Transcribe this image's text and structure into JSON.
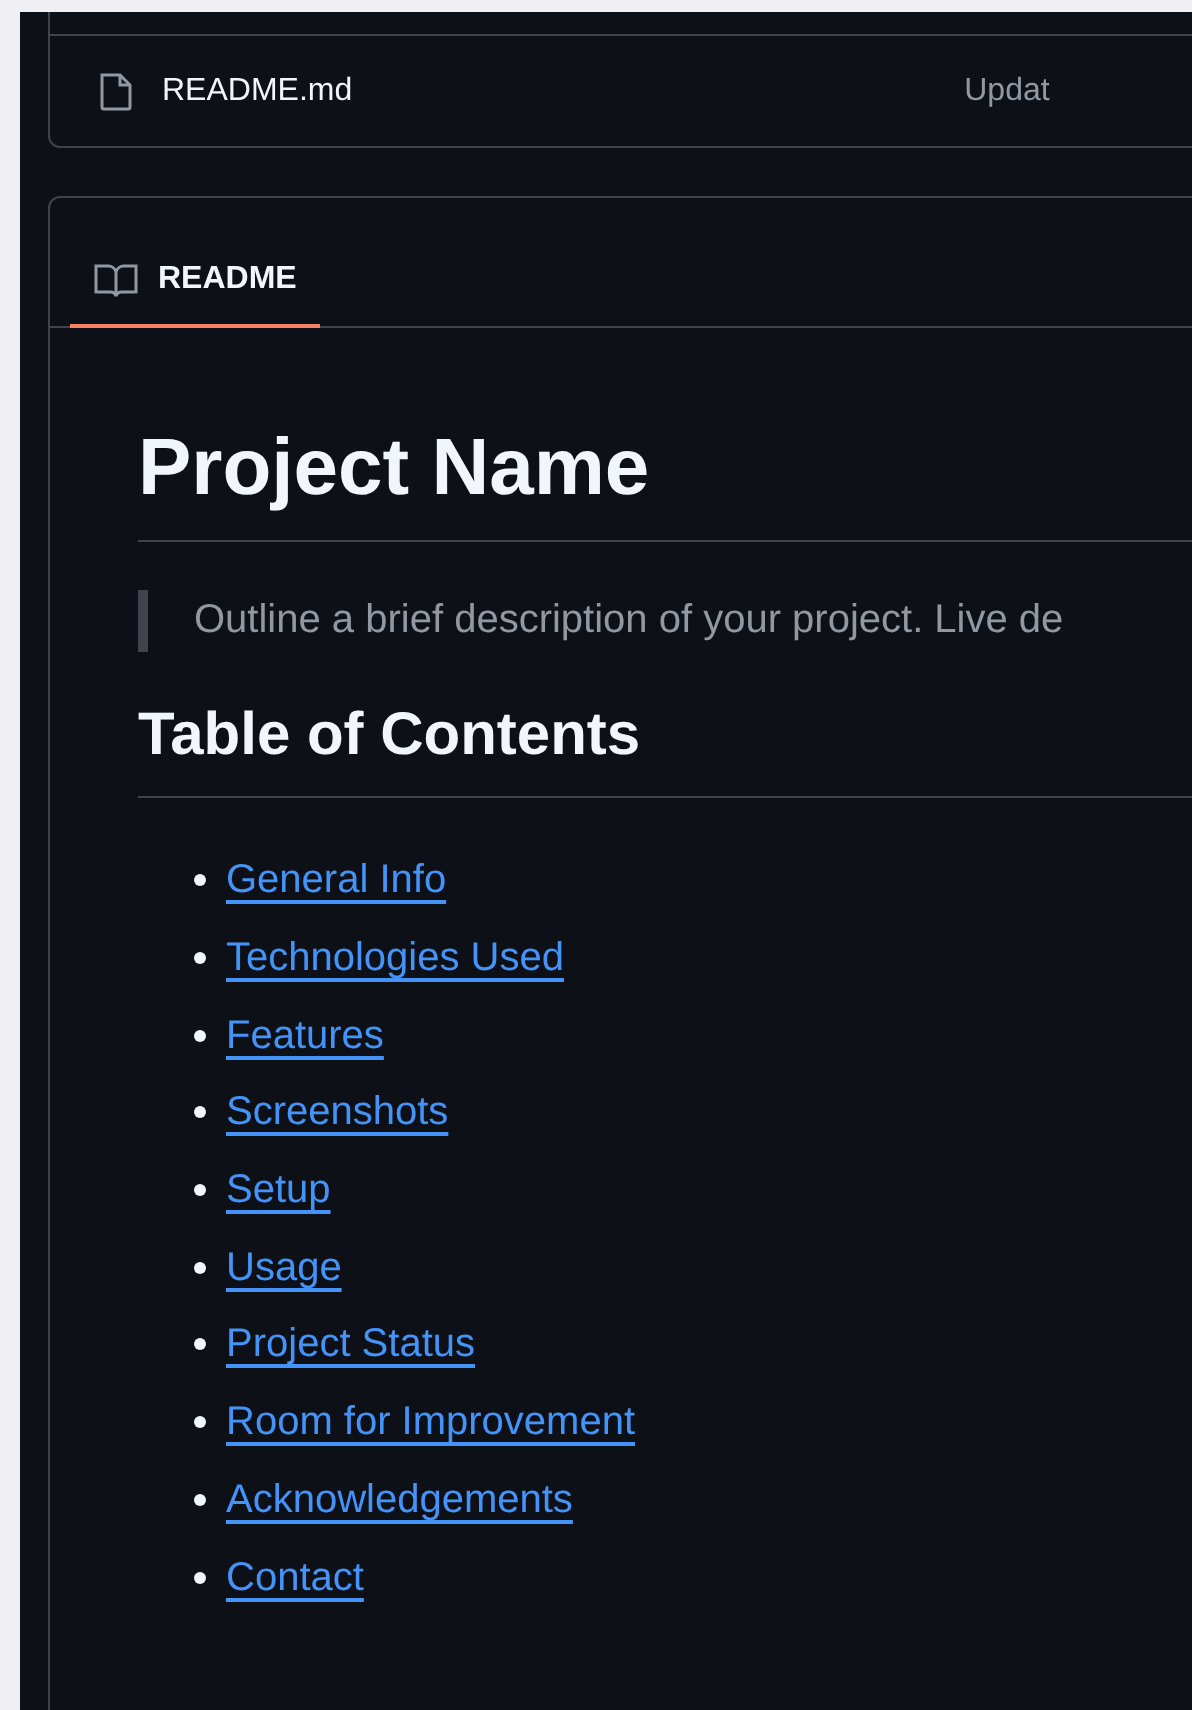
{
  "file_row": {
    "name": "README.md",
    "commit": "Updat"
  },
  "readme": {
    "tabs": [
      {
        "label": "README",
        "selected": true
      }
    ],
    "title": "Project Name",
    "blockquote": "Outline a brief description of your project. Live de",
    "toc_heading": "Table of Contents",
    "toc": [
      "General Info",
      "Technologies Used",
      "Features",
      "Screenshots",
      "Setup",
      "Usage",
      "Project Status",
      "Room for Improvement",
      "Acknowledgements",
      "Contact"
    ]
  }
}
